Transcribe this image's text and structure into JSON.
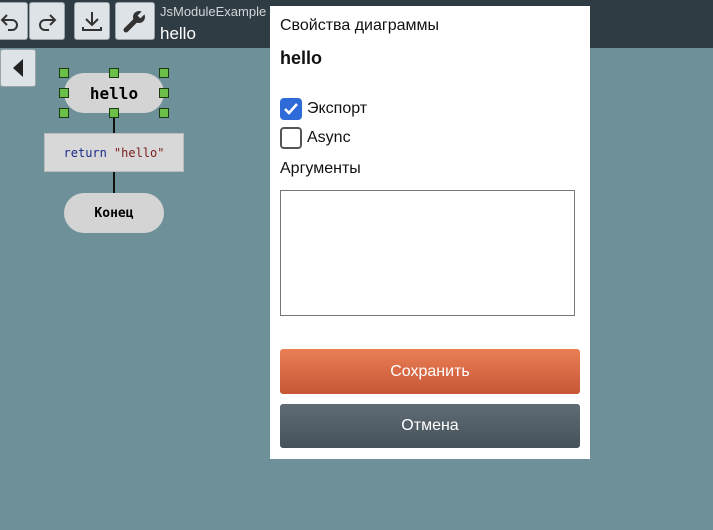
{
  "toolbar": {
    "app_title": "JsModuleExample",
    "diagram_name": "hello",
    "buttons": [
      {
        "name": "undo",
        "icon": "undo-icon"
      },
      {
        "name": "redo",
        "icon": "redo-icon"
      },
      {
        "name": "download",
        "icon": "download-icon"
      },
      {
        "name": "settings",
        "icon": "wrench-icon"
      }
    ],
    "collapse_icon": "triangle-left-icon"
  },
  "diagram": {
    "start_label": "hello",
    "action_keyword": "return",
    "action_value": "\"hello\"",
    "end_label": "Конец",
    "selection_color": "#6cc04a"
  },
  "dialog": {
    "title": "Свойства диаграммы",
    "name": "hello",
    "export_label": "Экспорт",
    "export_checked": true,
    "async_label": "Async",
    "async_checked": false,
    "args_label": "Аргументы",
    "args_value": "",
    "save_label": "Сохранить",
    "cancel_label": "Отмена",
    "save_color": "#e06a45",
    "cancel_color": "#55616a",
    "check_color": "#2f6bd8"
  }
}
